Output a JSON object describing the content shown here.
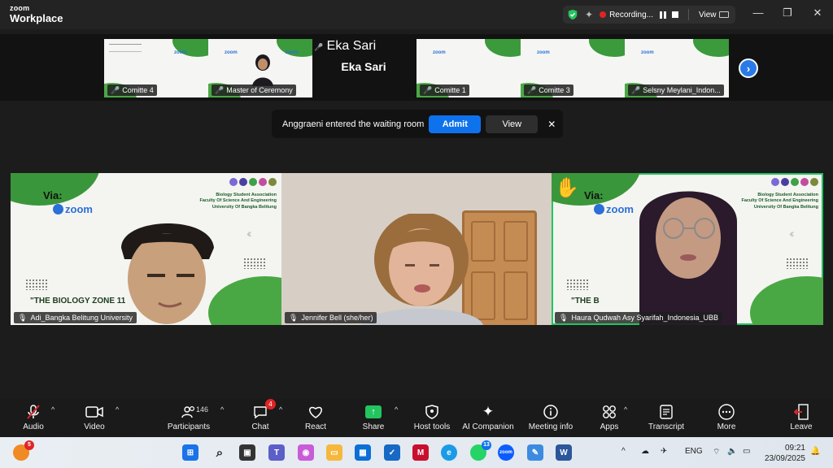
{
  "titlebar": {
    "brand_top": "zoom",
    "brand_bottom": "Workplace",
    "recording_label": "Recording...",
    "view_label": "View"
  },
  "gallery": {
    "tiles": [
      {
        "name": "Comitte 4"
      },
      {
        "name": "Master of Ceremony"
      },
      {
        "name": "Eka Sari"
      },
      {
        "name": "Comitte 1"
      },
      {
        "name": "Comitte 3"
      },
      {
        "name": "Selsny Meylani_Indon..."
      }
    ],
    "namecard_title": "Eka Sari"
  },
  "waiting_room": {
    "message": "Anggraeni entered the waiting room",
    "admit_label": "Admit",
    "view_label": "View",
    "close_glyph": "✕"
  },
  "main_tiles": [
    {
      "name": "Adi_Bangka Belitung University",
      "slide_via": "Via:",
      "slide_zoom": "zoom",
      "slide_org": [
        "Biology Student Association",
        "Faculty Of Science And Engineering",
        "University Of Bangka Belitung"
      ],
      "slide_zone": "\"THE BIOLOGY ZONE 11"
    },
    {
      "name": "Jennifer Bell (she/her)"
    },
    {
      "name": "Haura Qudwah Asy Syarifah_Indonesia_UBB",
      "slide_via": "Via:",
      "slide_zoom": "zoom",
      "slide_org": [
        "Biology Student Association",
        "Faculty Of Science And Engineering",
        "University Of Bangka Belitung"
      ],
      "slide_zone": "\"THE B"
    }
  ],
  "toolbar": {
    "audio": "Audio",
    "video": "Video",
    "participants": "Participants",
    "participants_count": "146",
    "chat": "Chat",
    "chat_badge": "4",
    "react": "React",
    "share": "Share",
    "host_tools": "Host tools",
    "ai_companion": "AI Companion",
    "meeting_info": "Meeting info",
    "apps": "Apps",
    "transcript": "Transcript",
    "more": "More",
    "leave": "Leave"
  },
  "taskbar": {
    "notif_badge": "5",
    "whatsapp_badge": "13",
    "zoom_label": "zoom",
    "language": "ENG",
    "time": "09:21",
    "date": "23/09/2025"
  },
  "colors": {
    "accent_blue": "#0e72ed",
    "active_green": "#22c55e",
    "rec_red": "#e02424",
    "slide_green": "#3a963a"
  }
}
